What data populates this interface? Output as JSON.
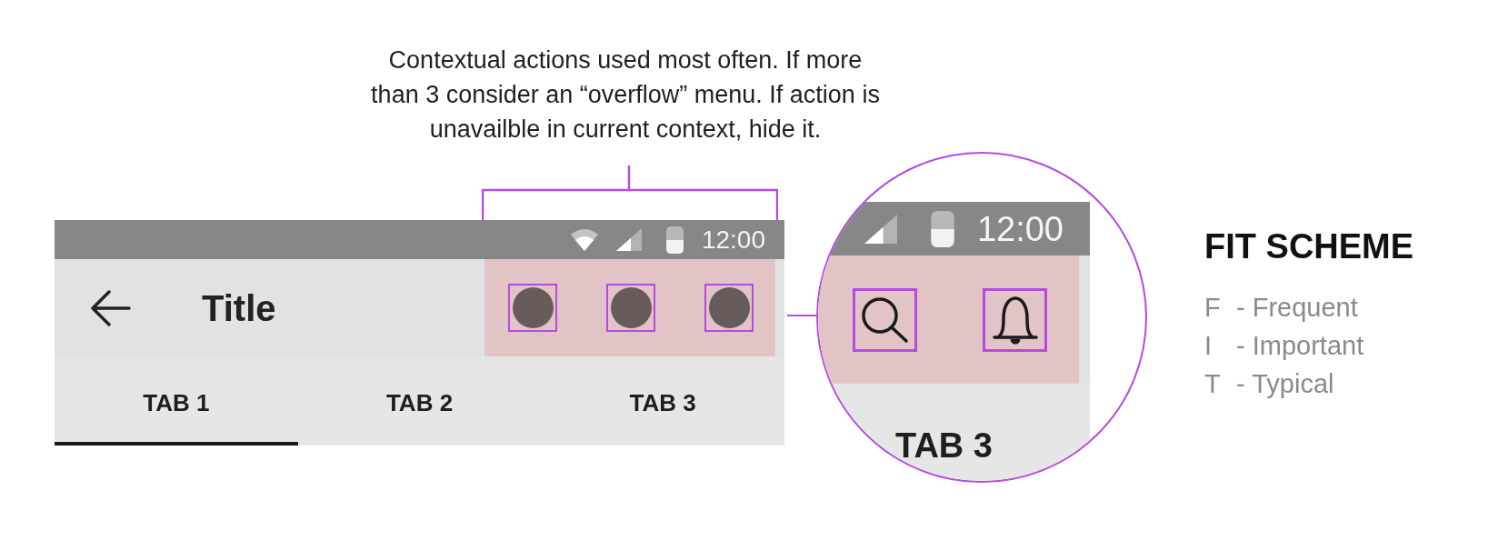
{
  "annotation": {
    "text": "Contextual actions used most often. If more than 3 consider an “overflow” menu. If action is unavailble in current context, hide it."
  },
  "phone": {
    "status_bar": {
      "time": "12:00"
    },
    "app_bar": {
      "title": "Title",
      "actions": [
        {
          "kind": "dot"
        },
        {
          "kind": "dot"
        },
        {
          "kind": "dot"
        }
      ]
    },
    "tabs": [
      {
        "label": "TAB 1",
        "selected": true
      },
      {
        "label": "TAB 2",
        "selected": false
      },
      {
        "label": "TAB 3",
        "selected": false
      }
    ]
  },
  "magnifier": {
    "status_bar": {
      "time": "12:00"
    },
    "actions": [
      {
        "kind": "search"
      },
      {
        "kind": "bell"
      }
    ],
    "tab_label": "TAB 3"
  },
  "fit_scheme": {
    "title": "FIT SCHEME",
    "items": [
      {
        "letter": "F",
        "meaning": "- Frequent"
      },
      {
        "letter": "I",
        "meaning": "- Important"
      },
      {
        "letter": "T",
        "meaning": "- Typical"
      }
    ]
  }
}
